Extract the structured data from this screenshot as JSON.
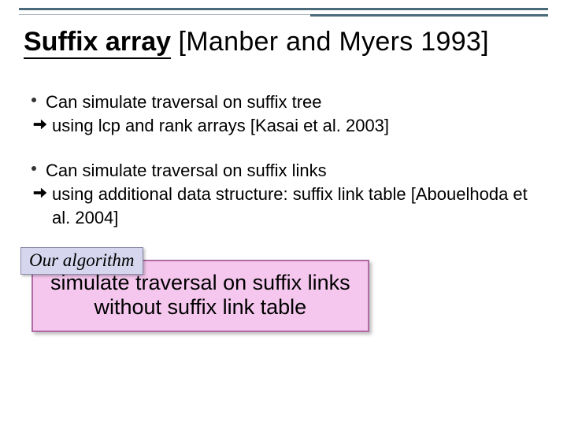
{
  "title": {
    "main": "Suffix array",
    "reference": "[Manber and Myers 1993]"
  },
  "bullets": {
    "g1": {
      "point": "Can simulate traversal on suffix tree",
      "followup": "using lcp and rank arrays [Kasai et al. 2003]"
    },
    "g2": {
      "point": "Can simulate traversal on suffix links",
      "followup": "using additional data structure: suffix link table [Abouelhoda et al. 2004]"
    }
  },
  "callout": {
    "tag": "Our algorithm",
    "line1": "simulate traversal on suffix links",
    "line2": "without suffix link table"
  }
}
